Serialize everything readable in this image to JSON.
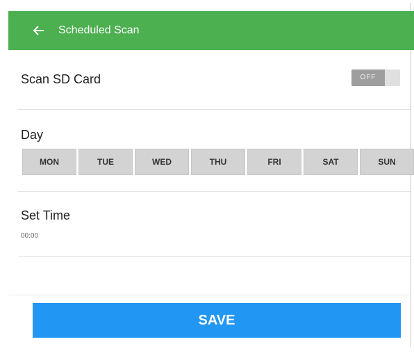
{
  "appbar": {
    "back_icon": "arrow-left-icon",
    "title": "Scheduled Scan",
    "color": "#4caf50"
  },
  "scan_sd_card": {
    "label": "Scan SD Card",
    "toggle_state": "OFF"
  },
  "day": {
    "label": "Day",
    "options": [
      "MON",
      "TUE",
      "WED",
      "THU",
      "FRI",
      "SAT",
      "SUN"
    ]
  },
  "set_time": {
    "label": "Set Time",
    "value": "00:00"
  },
  "save": {
    "label": "SAVE",
    "color": "#2196f3"
  }
}
